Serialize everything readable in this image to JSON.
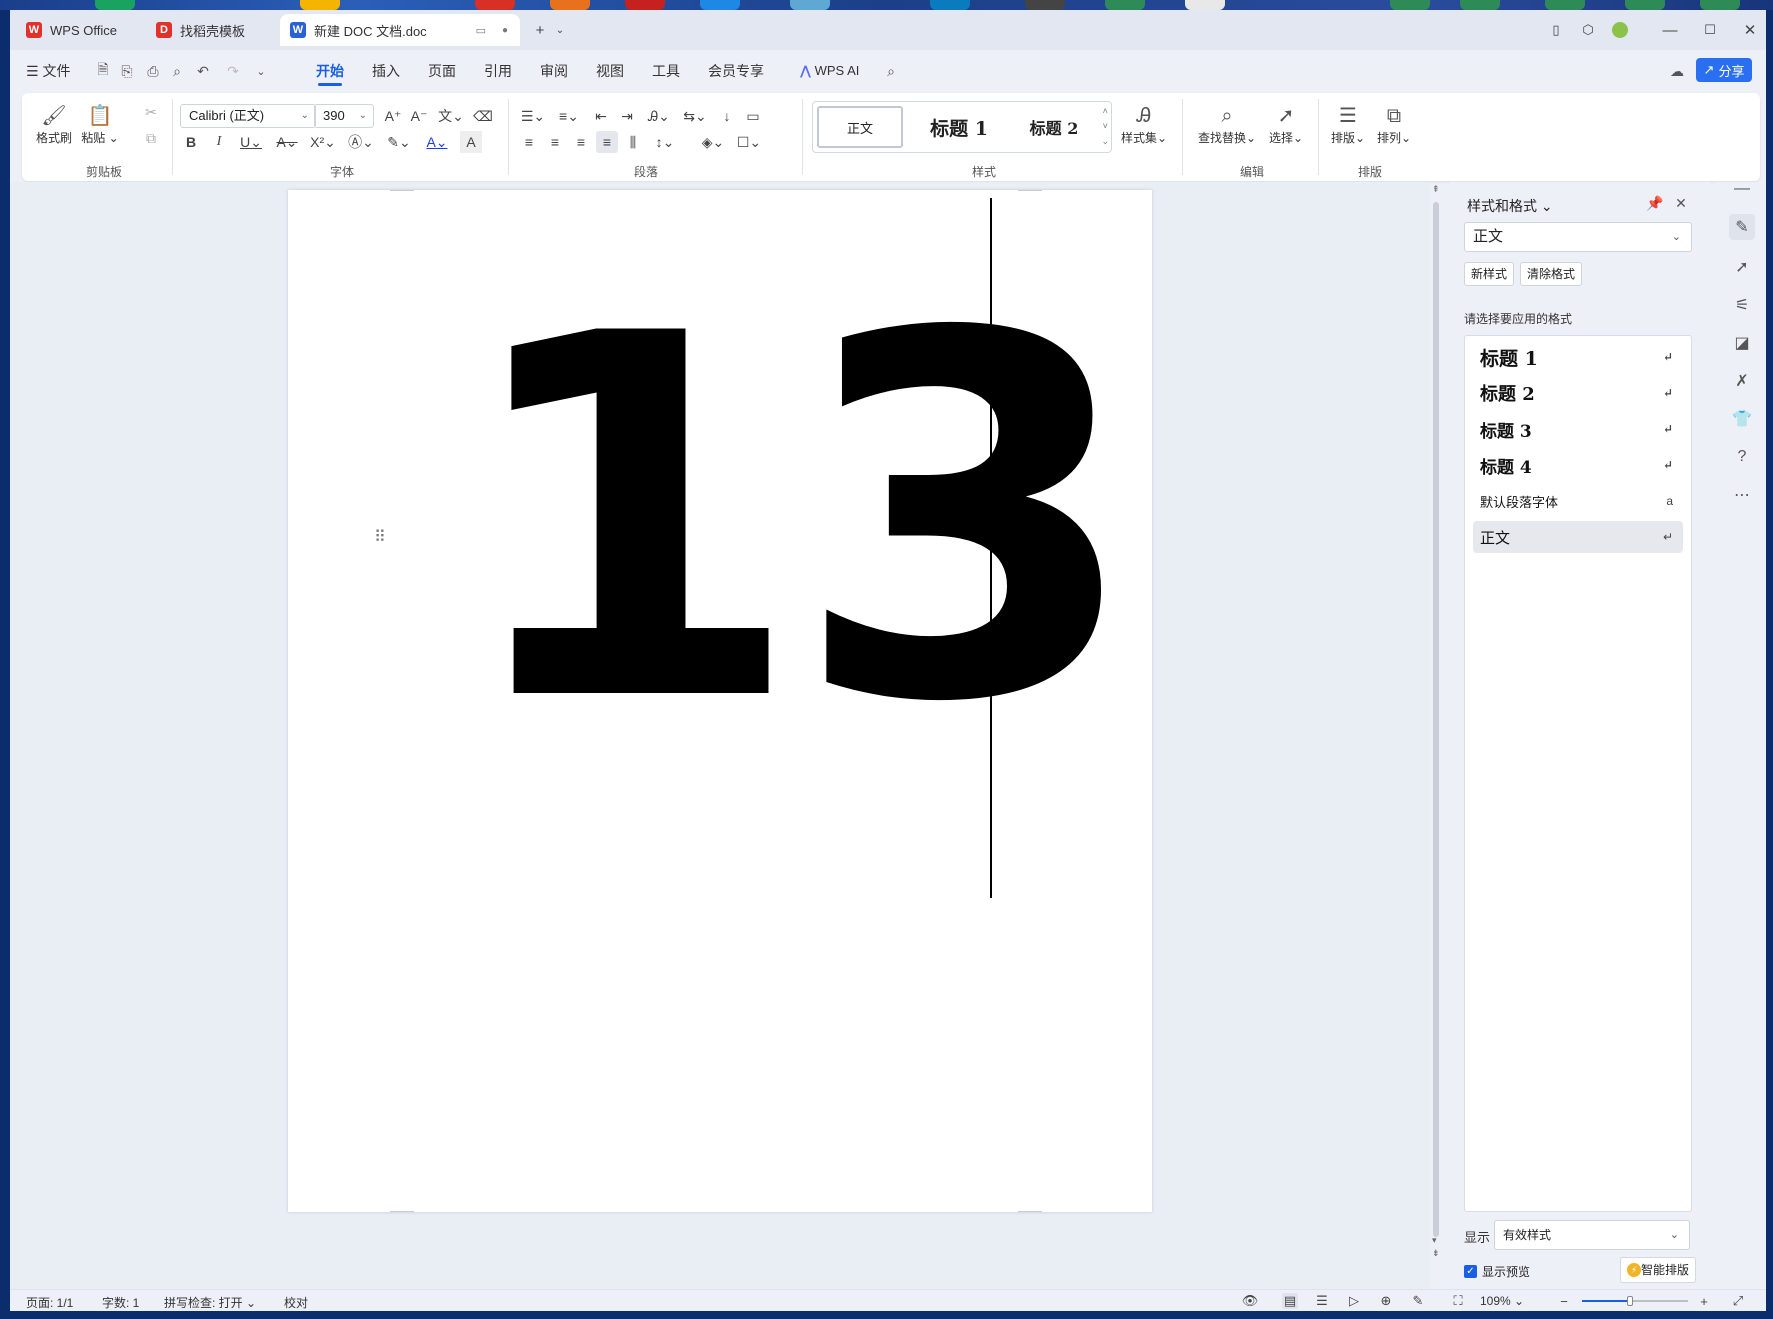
{
  "tabs": [
    {
      "label": "WPS Office",
      "icon": "wps-logo-icon",
      "color": "#e0312b"
    },
    {
      "label": "找稻壳模板",
      "icon": "docer-icon",
      "color": "#e0312b"
    },
    {
      "label": "新建 DOC 文档.doc",
      "icon": "word-doc-icon",
      "color": "#2a62d6"
    }
  ],
  "menu": {
    "file": "文件",
    "items": [
      "开始",
      "插入",
      "页面",
      "引用",
      "审阅",
      "视图",
      "工具",
      "会员专享"
    ],
    "active": "开始",
    "ai": "WPS AI",
    "share": "分享"
  },
  "ribbon": {
    "clipboard": {
      "format_painter": "格式刷",
      "paste": "粘贴",
      "group": "剪贴板"
    },
    "font": {
      "name": "Calibri (正文)",
      "size": "390",
      "group": "字体"
    },
    "paragraph": {
      "group": "段落"
    },
    "styles": {
      "normal": "正文",
      "h1": "标题 1",
      "h2": "标题 2",
      "style_set": "样式集",
      "group": "样式"
    },
    "edit": {
      "find_replace": "查找替换",
      "select": "选择",
      "group": "编辑"
    },
    "layout": {
      "typeset": "排版",
      "arrange": "排列",
      "group": "排版"
    }
  },
  "document": {
    "content": "13"
  },
  "pane": {
    "title": "样式和格式",
    "current_style": "正文",
    "new_style": "新样式",
    "clear_format": "清除格式",
    "hint": "请选择要应用的格式",
    "styles": [
      "标题 1",
      "标题 2",
      "标题 3",
      "标题 4",
      "默认段落字体",
      "正文"
    ],
    "selected_style": "正文",
    "show_label": "显示",
    "show_value": "有效样式",
    "preview_label": "显示预览",
    "preview_checked": true,
    "smart": "智能排版"
  },
  "status": {
    "page": "页面: 1/1",
    "words": "字数: 1",
    "spell": "拼写检查: 打开",
    "proof": "校对",
    "zoom": "109%",
    "zoom_fraction": 0.45
  },
  "colors": {
    "accent": "#1a5ee6",
    "share_bg": "#2a6ef2"
  }
}
